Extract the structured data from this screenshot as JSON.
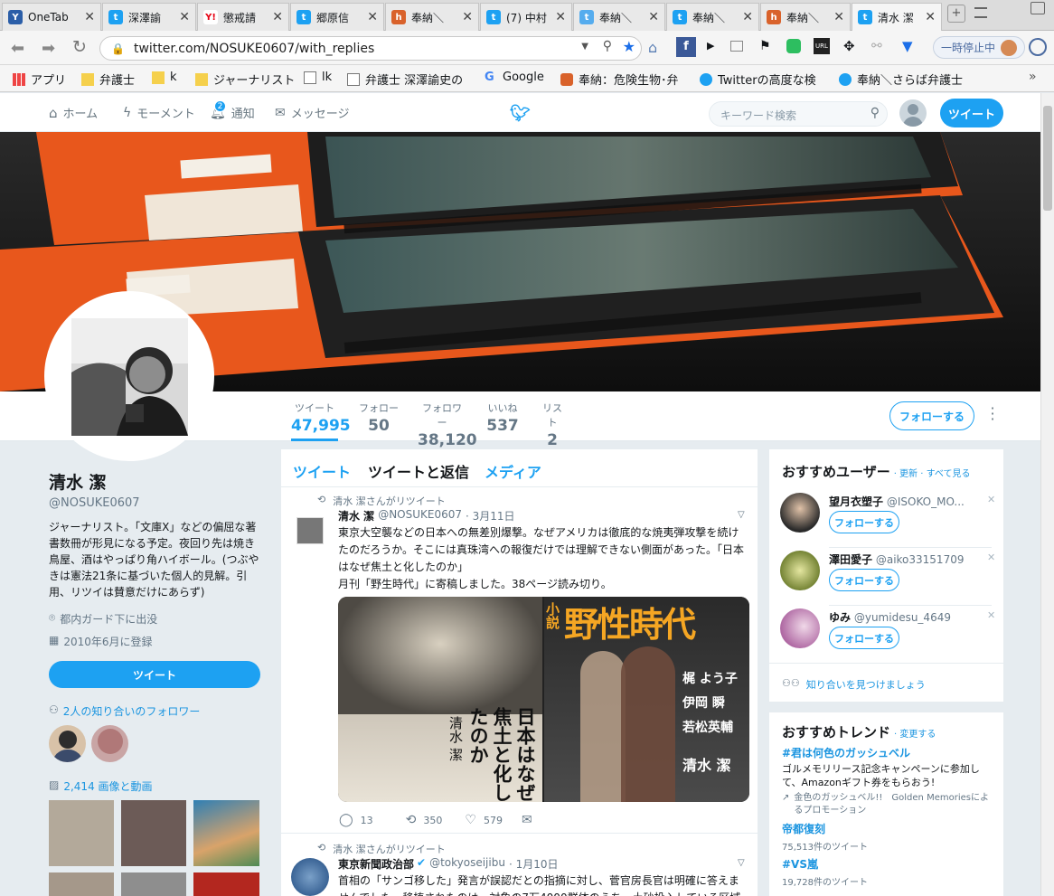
{
  "tabs": [
    {
      "label": "OneTab",
      "fav": "Y",
      "color": "#2b5ea8"
    },
    {
      "label": "深澤諭",
      "fav": "t",
      "color": "#1da1f2"
    },
    {
      "label": "懲戒請",
      "fav": "Y!",
      "color": "#e60012"
    },
    {
      "label": "郷原信",
      "fav": "t",
      "color": "#1da1f2"
    },
    {
      "label": "奉納＼",
      "fav": "h",
      "color": "#d9622b"
    },
    {
      "label": "(7) 中村",
      "fav": "t",
      "color": "#1da1f2"
    },
    {
      "label": "奉納＼",
      "fav": "t",
      "color": "#55acee"
    },
    {
      "label": "奉納＼",
      "fav": "t",
      "color": "#1da1f2"
    },
    {
      "label": "奉納＼",
      "fav": "h",
      "color": "#d9622b"
    },
    {
      "label": "清水 潔",
      "fav": "t",
      "color": "#1da1f2"
    }
  ],
  "address": {
    "url": "twitter.com/NOSUKE0607/with_replies",
    "pause_label": "一時停止中"
  },
  "bookmarks": [
    {
      "label": "アプリ"
    },
    {
      "label": "弁護士"
    },
    {
      "label": "k"
    },
    {
      "label": "ジャーナリスト"
    },
    {
      "label": "lk"
    },
    {
      "label": "弁護士 深澤諭史の"
    },
    {
      "label": "Google"
    },
    {
      "label": "奉納：危険生物･弁"
    },
    {
      "label": "Twitterの高度な検"
    },
    {
      "label": "奉納＼さらば弁護士"
    }
  ],
  "twnav": {
    "home": "ホーム",
    "moments": "モーメント",
    "notifications": "通知",
    "notif_count": "2",
    "messages": "メッセージ",
    "search_placeholder": "キーワード検索",
    "tweet_button": "ツイート"
  },
  "profile": {
    "name": "清水 潔",
    "handle": "@NOSUKE0607",
    "bio": "ジャーナリスト。「文庫X」などの偏屈な著書数冊が形見になる予定。夜回り先は焼き鳥屋、酒はやっぱり角ハイボール。(つぶやきは憲法21条に基づいた個人的見解。引用、リツイは賛意だけにあらず)",
    "location": "都内ガード下に出没",
    "joined": "2010年6月に登録",
    "tweet_button": "ツイート",
    "followers_you_know": "2人の知り合いのフォロワー",
    "media_count": "2,414 画像と動画",
    "follow_button": "フォローする"
  },
  "stats": [
    {
      "label": "ツイート",
      "value": "47,995"
    },
    {
      "label": "フォロー",
      "value": "50"
    },
    {
      "label": "フォロワー",
      "value": "38,120"
    },
    {
      "label": "いいね",
      "value": "537"
    },
    {
      "label": "リスト",
      "value": "2"
    }
  ],
  "timeline": {
    "tabs": [
      "ツイート",
      "ツイートと返信",
      "メディア"
    ],
    "tweet1": {
      "retweet_label": "清水 潔さんがリツイート",
      "name": "清水 潔",
      "handle": "@NOSUKE0607",
      "date": "· 3月11日",
      "text": "東京大空襲などの日本への無差別爆撃。なぜアメリカは徹底的な焼夷弾攻撃を続けたのだろうか。そこには真珠湾への報復だけでは理解できない側面があった。「日本はなぜ焦土と化したのか」",
      "text2": "月刊「野生時代」に寄稿しました。38ページ読み切り。",
      "replies": "13",
      "retweets": "350",
      "likes": "579",
      "img1_title": "日本はなぜ焦土と化したのか",
      "img1_author": "清水 潔",
      "img2_small": "小説",
      "img2_title": "野性時代",
      "img2_names": [
        "梶 よう子",
        "伊岡 瞬",
        "若松英輔",
        "清水 潔"
      ]
    },
    "tweet2": {
      "retweet_label": "清水 潔さんがリツイート",
      "name": "東京新聞政治部",
      "handle": "@tokyoseijibu",
      "date": "· 1月10日",
      "text": "首相の「サンゴ移した」発言が誤認だとの指摘に対し、菅官房長官は明確に答えませんでした。移植されたのは、対象の7万4000群体のうち、土砂投入している区域とは別区"
    }
  },
  "whotofollow": {
    "title": "おすすめユーザー",
    "links": "· 更新 · すべて見る",
    "users": [
      {
        "name": "望月衣塑子",
        "handle": "@ISOKO_MO..."
      },
      {
        "name": "澤田愛子",
        "handle": "@aiko33151709"
      },
      {
        "name": "ゆみ",
        "handle": "@yumidesu_4649"
      }
    ],
    "follow_label": "フォローする",
    "find_friends": "知り合いを見つけましょう"
  },
  "trends": {
    "title": "おすすめトレンド",
    "change": "· 変更する",
    "items": [
      {
        "tag": "#君は何色のガッシュベル",
        "desc": "ゴルメモリリース記念キャンペーンに参加して、Amazonギフト券をもらおう!",
        "promo": "金色のガッシュベル!!　Golden Memoriesによるプロモーション"
      },
      {
        "tag": "帝都復刻",
        "count": "75,513件のツイート"
      },
      {
        "tag": "#VS嵐",
        "count": "19,728件のツイート"
      }
    ]
  },
  "colors": {
    "accent": "#1da1f2",
    "link": "#1b95e0",
    "bg": "#e6ecf0",
    "cover_orange": "#e8571c"
  }
}
